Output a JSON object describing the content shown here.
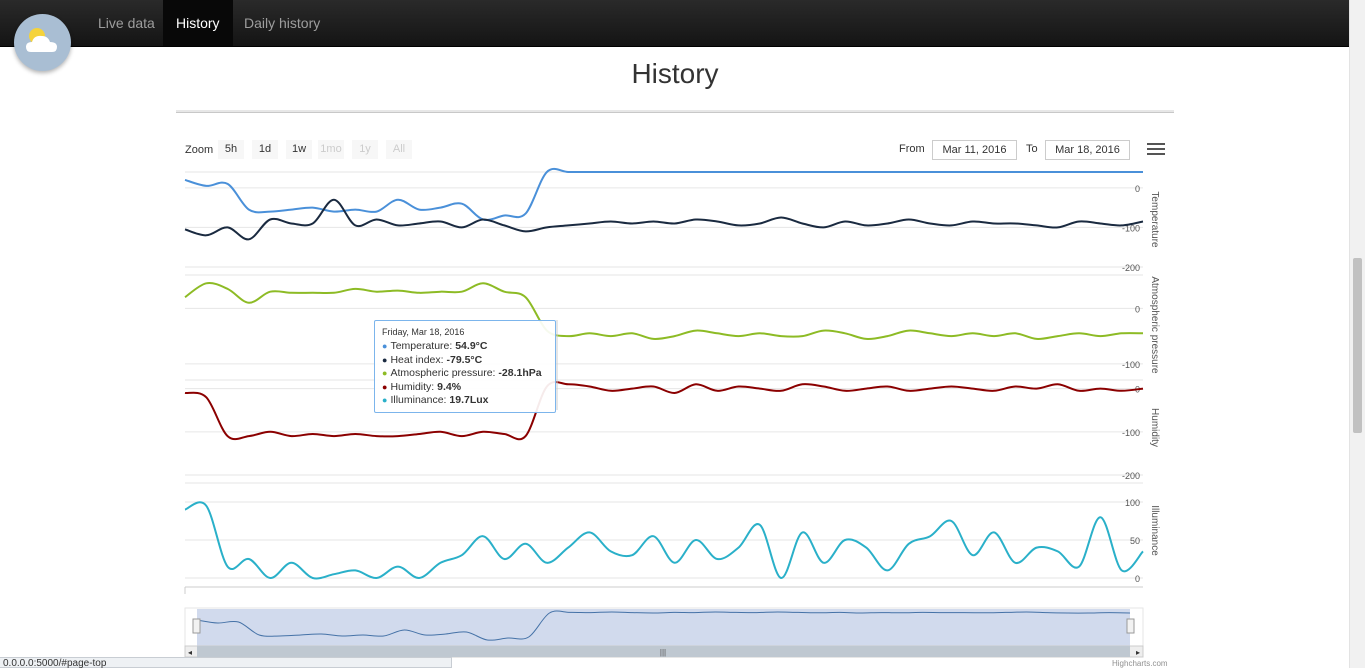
{
  "nav": {
    "items": [
      "Live data",
      "History",
      "Daily history"
    ],
    "active": "History"
  },
  "page": {
    "title": "History"
  },
  "range_selector": {
    "zoom_label": "Zoom",
    "buttons": [
      {
        "label": "5h",
        "enabled": true
      },
      {
        "label": "1d",
        "enabled": true
      },
      {
        "label": "1w",
        "enabled": true
      },
      {
        "label": "1mo",
        "enabled": false
      },
      {
        "label": "1y",
        "enabled": false
      },
      {
        "label": "All",
        "enabled": false
      }
    ],
    "from_label": "From",
    "from_value": "Mar 11, 2016",
    "to_label": "To",
    "to_value": "Mar 18, 2016"
  },
  "tooltip": {
    "date": "Friday, Mar 18, 2016",
    "rows": [
      {
        "label": "Temperature: ",
        "value": "54.9°C",
        "color": "#4a90d9"
      },
      {
        "label": "Heat index: ",
        "value": "-79.5°C",
        "color": "#1a2a40"
      },
      {
        "label": "Atmospheric pressure: ",
        "value": "-28.1hPa",
        "color": "#8dbb25"
      },
      {
        "label": "Humidity: ",
        "value": "9.4%",
        "color": "#8b0000"
      },
      {
        "label": "Illuminance: ",
        "value": "19.7Lux",
        "color": "#2ab0c9"
      }
    ]
  },
  "chart_data": [
    {
      "type": "line",
      "ylabel": "Temperature",
      "yticks": [
        "0",
        "-100",
        "-200"
      ],
      "series": [
        {
          "name": "Temperature",
          "color": "#4a90d9",
          "values": [
            20,
            5,
            10,
            -55,
            -60,
            -55,
            -50,
            -60,
            -55,
            -60,
            -30,
            -55,
            -50,
            -40,
            -80,
            -70,
            -65,
            55,
            58,
            57,
            60,
            57,
            55,
            58,
            57,
            60,
            58,
            57,
            60,
            58,
            56,
            58,
            55,
            57,
            56,
            58,
            57,
            57,
            56,
            58,
            60,
            57,
            55,
            55,
            57,
            55
          ]
        },
        {
          "name": "Heat index",
          "color": "#1a2a40",
          "values": [
            -105,
            -120,
            -100,
            -130,
            -80,
            -90,
            -90,
            -30,
            -95,
            -80,
            -95,
            -90,
            -85,
            -100,
            -80,
            -95,
            -110,
            -100,
            -95,
            -90,
            -85,
            -90,
            -85,
            -90,
            -80,
            -85,
            -95,
            -90,
            -75,
            -90,
            -100,
            -85,
            -95,
            -90,
            -80,
            -90,
            -95,
            -85,
            -90,
            -90,
            -95,
            -100,
            -85,
            -90,
            -95,
            -85
          ]
        }
      ]
    },
    {
      "type": "line",
      "ylabel": "Atmospheric pressure",
      "yticks": [
        "0",
        "-100"
      ],
      "series": [
        {
          "name": "Atmospheric pressure",
          "color": "#8dbb25",
          "values": [
            20,
            45,
            35,
            10,
            30,
            28,
            28,
            28,
            35,
            30,
            32,
            28,
            30,
            30,
            45,
            30,
            20,
            -40,
            -50,
            -45,
            -50,
            -45,
            -55,
            -50,
            -40,
            -45,
            -50,
            -45,
            -50,
            -50,
            -40,
            -45,
            -55,
            -50,
            -40,
            -45,
            -50,
            -45,
            -50,
            -45,
            -55,
            -50,
            -45,
            -50,
            -45,
            -45
          ]
        }
      ]
    },
    {
      "type": "line",
      "ylabel": "Humidity",
      "yticks": [
        "0",
        "-100",
        "-200"
      ],
      "series": [
        {
          "name": "Humidity",
          "color": "#8b0000",
          "values": [
            -10,
            -20,
            -110,
            -110,
            -100,
            -110,
            -105,
            -110,
            -105,
            -110,
            -110,
            -105,
            -100,
            -110,
            -100,
            -105,
            -110,
            5,
            10,
            5,
            -5,
            0,
            5,
            -10,
            10,
            -5,
            5,
            0,
            -5,
            10,
            5,
            -5,
            0,
            5,
            -5,
            0,
            5,
            0,
            -5,
            5,
            0,
            10,
            -5,
            0,
            -5,
            0
          ]
        }
      ]
    },
    {
      "type": "line",
      "ylabel": "Illuminance",
      "yticks": [
        "100",
        "50",
        "0"
      ],
      "series": [
        {
          "name": "Illuminance",
          "color": "#2ab0c9",
          "values": [
            90,
            95,
            15,
            25,
            -5,
            20,
            -5,
            5,
            10,
            -5,
            15,
            -10,
            20,
            30,
            55,
            25,
            45,
            20,
            40,
            60,
            35,
            30,
            55,
            20,
            50,
            25,
            40,
            70,
            -10,
            60,
            20,
            50,
            40,
            10,
            45,
            55,
            75,
            30,
            60,
            20,
            40,
            35,
            15,
            80,
            10,
            35
          ]
        }
      ]
    }
  ],
  "navigator": {
    "series": "Temperature"
  },
  "credits": "Highcharts.com",
  "status_bar": "0.0.0.0:5000/#page-top"
}
